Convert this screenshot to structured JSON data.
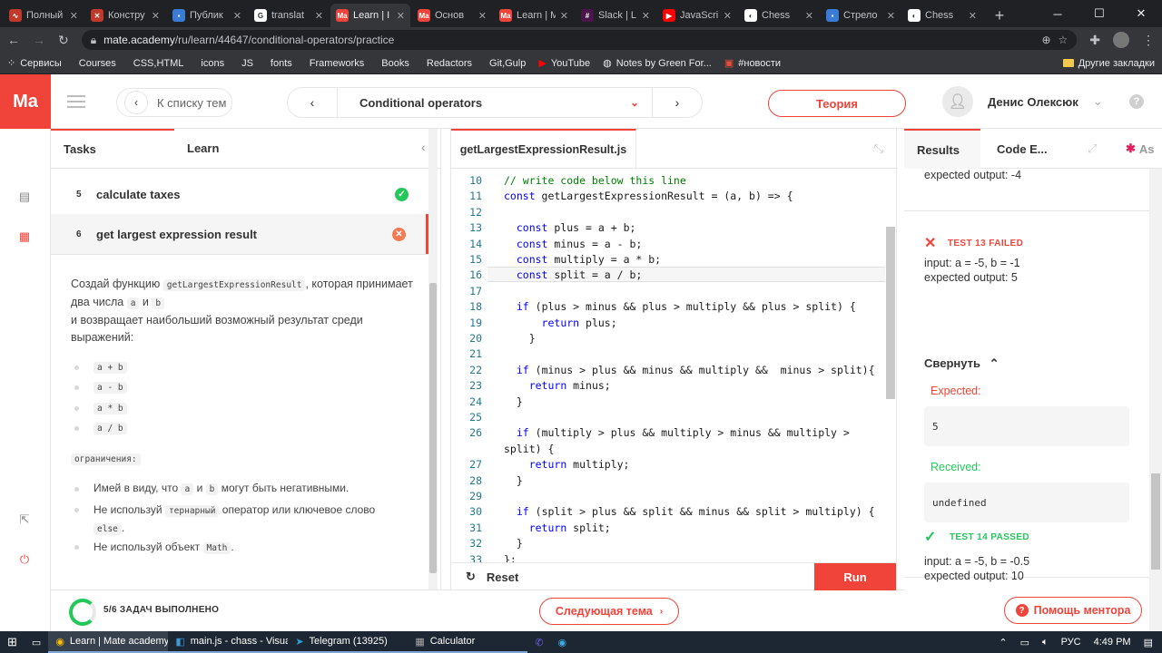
{
  "browser": {
    "tabs": [
      {
        "title": "Полный",
        "fav_color": "#c0392b",
        "fav_glyph": "∿"
      },
      {
        "title": "Констру",
        "fav_color": "#c0392b",
        "fav_glyph": "✕"
      },
      {
        "title": "Публик",
        "fav_color": "#3a7bd5",
        "fav_glyph": "▪"
      },
      {
        "title": "translat",
        "fav_color": "#ffffff",
        "fav_glyph": "G"
      },
      {
        "title": "Learn | I",
        "fav_color": "#f0443a",
        "fav_glyph": "Ma",
        "active": true
      },
      {
        "title": "Основ",
        "fav_color": "#f0443a",
        "fav_glyph": "Ma"
      },
      {
        "title": "Learn | M",
        "fav_color": "#f0443a",
        "fav_glyph": "Ma"
      },
      {
        "title": "Slack | L",
        "fav_color": "#4a154b",
        "fav_glyph": "#"
      },
      {
        "title": "JavaScri",
        "fav_color": "#ff0000",
        "fav_glyph": "▶"
      },
      {
        "title": "Chess",
        "fav_color": "#ffffff",
        "fav_glyph": "◐"
      },
      {
        "title": "Стрело",
        "fav_color": "#3a7bd5",
        "fav_glyph": "▪"
      },
      {
        "title": "Chess",
        "fav_color": "#ffffff",
        "fav_glyph": "◐"
      }
    ],
    "url_host": "mate.academy",
    "url_path": "/ru/learn/44647/conditional-operators/practice",
    "bookmarks": [
      {
        "label": "Сервисы",
        "icon": "apps-icon"
      },
      {
        "label": "Courses",
        "icon": "folder-icon"
      },
      {
        "label": "CSS,HTML",
        "icon": "folder-icon"
      },
      {
        "label": "icons",
        "icon": "folder-icon"
      },
      {
        "label": "JS",
        "icon": "folder-icon"
      },
      {
        "label": "fonts",
        "icon": "folder-icon"
      },
      {
        "label": "Frameworks",
        "icon": "folder-icon"
      },
      {
        "label": "Books",
        "icon": "folder-icon"
      },
      {
        "label": "Redactors",
        "icon": "folder-icon"
      },
      {
        "label": "Git,Gulp",
        "icon": "folder-icon"
      },
      {
        "label": "YouTube",
        "icon": "youtube-icon"
      },
      {
        "label": "Notes by Green For...",
        "icon": "globe-icon"
      },
      {
        "label": "#новости",
        "icon": "news-icon"
      }
    ],
    "other_bookmarks": "Другие закладки"
  },
  "header": {
    "logo": "Ma",
    "back_label": "К списку тем",
    "topic": "Conditional operators",
    "theory_label": "Теория",
    "user_name": "Денис Олексюк",
    "help": "?"
  },
  "left_panel": {
    "tabs": [
      "Tasks",
      "Learn"
    ],
    "tasks": [
      {
        "num": "5",
        "title": "calculate taxes",
        "status": "passed"
      },
      {
        "num": "6",
        "title": "get largest expression result",
        "status": "failed"
      }
    ],
    "desc_1": "Создай функцию",
    "desc_fn": "getLargestExpressionResult",
    "desc_2": ", которая принимает два числа",
    "desc_a": "a",
    "desc_and": "и",
    "desc_b": "b",
    "desc_3": "и возвращает наибольший возможный результат среди выражений:",
    "ops": [
      "a + b",
      "a - b",
      "a * b",
      "a / b"
    ],
    "restrictions_label": "ограничения:",
    "rule1_pre": "Имей в виду, что",
    "rule1_a": "a",
    "rule1_and": "и",
    "rule1_b": "b",
    "rule1_post": "могут быть негативными.",
    "rule2_pre": "Не используй",
    "rule2_code": "тернарный",
    "rule2_post": "оператор или ключевое слово",
    "rule2_else": "else",
    "rule2_end": ".",
    "rule3_pre": "Не используй объект",
    "rule3_code": "Math",
    "rule3_end": "."
  },
  "progress": {
    "text": "5/6 ЗАДАЧ ВЫПОЛНЕНО",
    "completed": 5,
    "total": 6,
    "next_topic": "Следующая тема"
  },
  "editor": {
    "filename": "getLargestExpressionResult.js",
    "lines": [
      {
        "n": "10",
        "text": "// write code below this line",
        "kind": "comment"
      },
      {
        "n": "11",
        "text": "const getLargestExpressionResult = (a, b) => {"
      },
      {
        "n": "12",
        "text": ""
      },
      {
        "n": "13",
        "text": "  const plus = a + b;"
      },
      {
        "n": "14",
        "text": "  const minus = a - b;"
      },
      {
        "n": "15",
        "text": "  const multiply = a * b;"
      },
      {
        "n": "16",
        "text": "  const split = a / b;",
        "current": true
      },
      {
        "n": "17",
        "text": ""
      },
      {
        "n": "18",
        "text": "  if (plus > minus && plus > multiply && plus > split) {"
      },
      {
        "n": "19",
        "text": "      return plus;"
      },
      {
        "n": "20",
        "text": "    }"
      },
      {
        "n": "21",
        "text": ""
      },
      {
        "n": "22",
        "text": "  if (minus > plus && minus && multiply &&  minus > split){"
      },
      {
        "n": "23",
        "text": "    return minus;"
      },
      {
        "n": "24",
        "text": "  }"
      },
      {
        "n": "25",
        "text": ""
      },
      {
        "n": "26",
        "text": "  if (multiply > plus && multiply > minus && multiply >"
      },
      {
        "n": "",
        "text": "split) {"
      },
      {
        "n": "27",
        "text": "    return multiply;"
      },
      {
        "n": "28",
        "text": "  }"
      },
      {
        "n": "29",
        "text": ""
      },
      {
        "n": "30",
        "text": "  if (split > plus && split && minus && split > multiply) {"
      },
      {
        "n": "31",
        "text": "    return split;"
      },
      {
        "n": "32",
        "text": "  }"
      },
      {
        "n": "33",
        "text": "};"
      }
    ],
    "reset_label": "Reset",
    "run_label": "Run"
  },
  "results": {
    "tabs": [
      "Results",
      "Code E...",
      "As"
    ],
    "prev_output": "expected output: -4",
    "fail_title": "TEST 13 FAILED",
    "fail_input": "input: a = -5, b = -1",
    "fail_expected": "expected output: 5",
    "collapse_label": "Свернуть",
    "expected_label": "Expected:",
    "expected_value": "5",
    "received_label": "Received:",
    "received_value": "undefined",
    "pass_title": "TEST 14 PASSED",
    "pass_input": "input: a = -5, b = -0.5",
    "pass_expected": "expected output: 10",
    "mentor_label": "Помощь ментора"
  },
  "taskbar": {
    "items": [
      {
        "label": "Learn | Mate academy...",
        "icon": "chrome-icon"
      },
      {
        "label": "main.js - chass - Visua...",
        "icon": "vscode-icon"
      },
      {
        "label": "Telegram (13925)",
        "icon": "telegram-icon"
      },
      {
        "label": "Calculator",
        "icon": "calculator-icon"
      }
    ],
    "lang": "РУС",
    "time": "4:49 PM"
  }
}
